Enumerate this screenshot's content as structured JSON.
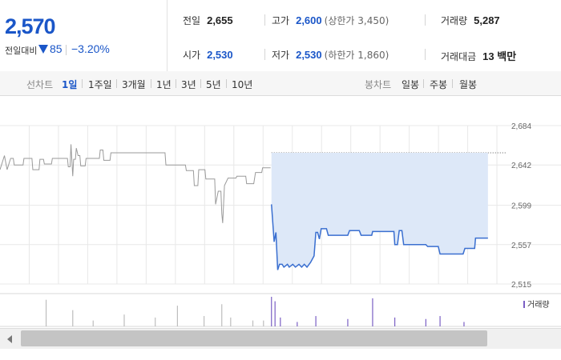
{
  "summary": {
    "current_price": "2,570",
    "change_label": "전일대비",
    "change_amount": "85",
    "change_rate": "−3.20%",
    "stats": {
      "prev_close": {
        "label": "전일",
        "value": "2,655"
      },
      "high": {
        "label": "고가",
        "value": "2,600",
        "sub": "(상한가 3,450)"
      },
      "volume": {
        "label": "거래량",
        "value": "5,287"
      },
      "open": {
        "label": "시가",
        "value": "2,530"
      },
      "low": {
        "label": "저가",
        "value": "2,530",
        "sub": "(하한가 1,860)"
      },
      "trade_value": {
        "label": "거래대금",
        "value": "13 백만"
      }
    }
  },
  "tabs": {
    "line_label": "선차트",
    "line_items": [
      "1일",
      "1주일",
      "3개월",
      "1년",
      "3년",
      "5년",
      "10년"
    ],
    "active": "1일",
    "candle_label": "봉차트",
    "candle_items": [
      "일봉",
      "주봉",
      "월봉"
    ]
  },
  "chart_data": {
    "type": "line",
    "y_ticks": [
      2684,
      2642,
      2599,
      2557,
      2515
    ],
    "ylim": [
      2515,
      2684
    ],
    "prev_close_ref": 2655,
    "grid": true,
    "series": [
      {
        "values": [
          [
            0,
            2637
          ],
          [
            0.5,
            2652
          ],
          [
            0.8,
            2637
          ],
          [
            1.2,
            2649
          ],
          [
            1.5,
            2649
          ],
          [
            1.6,
            2642
          ],
          [
            2.6,
            2642
          ],
          [
            2.7,
            2649
          ],
          [
            3.6,
            2649
          ],
          [
            3.7,
            2637
          ],
          [
            4.4,
            2637
          ],
          [
            4.5,
            2648
          ],
          [
            4.9,
            2648
          ],
          [
            5.0,
            2643
          ],
          [
            5.8,
            2643
          ],
          [
            5.9,
            2649
          ],
          [
            7.6,
            2649
          ],
          [
            7.7,
            2640
          ],
          [
            7.9,
            2640
          ],
          [
            8.0,
            2664
          ],
          [
            8.2,
            2630
          ],
          [
            8.3,
            2648
          ],
          [
            8.5,
            2648
          ],
          [
            8.6,
            2660
          ],
          [
            8.8,
            2652
          ],
          [
            9.0,
            2652
          ],
          [
            9.1,
            2641
          ],
          [
            9.6,
            2641
          ],
          [
            9.7,
            2649
          ],
          [
            11.2,
            2649
          ],
          [
            11.3,
            2658
          ],
          [
            11.6,
            2658
          ],
          [
            11.7,
            2647
          ],
          [
            12.4,
            2647
          ],
          [
            12.5,
            2655
          ],
          [
            18.6,
            2655
          ],
          [
            18.7,
            2642
          ],
          [
            20.9,
            2642
          ],
          [
            21.0,
            2636
          ],
          [
            21.8,
            2636
          ],
          [
            21.9,
            2620
          ],
          [
            22.3,
            2620
          ],
          [
            22.4,
            2637
          ],
          [
            23.1,
            2637
          ],
          [
            23.2,
            2627
          ],
          [
            24.2,
            2627
          ],
          [
            24.3,
            2600
          ],
          [
            24.6,
            2614
          ],
          [
            24.9,
            2614
          ],
          [
            25.0,
            2590
          ],
          [
            25.1,
            2580
          ],
          [
            25.3,
            2620
          ],
          [
            25.7,
            2628
          ],
          [
            26.6,
            2628
          ],
          [
            26.7,
            2630
          ],
          [
            27.7,
            2630
          ],
          [
            27.8,
            2622
          ],
          [
            28.6,
            2622
          ],
          [
            28.8,
            2634
          ],
          [
            29.5,
            2634
          ],
          [
            29.6,
            2639
          ],
          [
            30.5,
            2639
          ]
        ],
        "color": "#9a9a9a"
      },
      {
        "values": [
          [
            30.6,
            2600
          ],
          [
            30.9,
            2560
          ],
          [
            31.1,
            2570
          ],
          [
            31.3,
            2530
          ],
          [
            31.5,
            2536
          ],
          [
            31.8,
            2536
          ],
          [
            32.0,
            2533
          ],
          [
            32.4,
            2536
          ],
          [
            32.6,
            2533
          ],
          [
            33.0,
            2536
          ],
          [
            33.3,
            2533
          ],
          [
            33.7,
            2536
          ],
          [
            34.0,
            2533
          ],
          [
            34.3,
            2536
          ],
          [
            34.6,
            2533
          ],
          [
            35.0,
            2538
          ],
          [
            35.4,
            2545
          ],
          [
            35.6,
            2570
          ],
          [
            35.8,
            2570
          ],
          [
            36.0,
            2563
          ],
          [
            36.2,
            2574
          ],
          [
            36.8,
            2574
          ],
          [
            37.0,
            2567
          ],
          [
            39.2,
            2567
          ],
          [
            39.4,
            2572
          ],
          [
            40.5,
            2572
          ],
          [
            40.7,
            2567
          ],
          [
            41.9,
            2567
          ],
          [
            42.0,
            2571
          ],
          [
            44.4,
            2571
          ],
          [
            44.5,
            2557
          ],
          [
            44.8,
            2557
          ],
          [
            45.0,
            2572
          ],
          [
            45.3,
            2572
          ],
          [
            45.5,
            2557
          ],
          [
            48.0,
            2557
          ],
          [
            48.2,
            2555
          ],
          [
            49.4,
            2555
          ],
          [
            49.6,
            2547
          ],
          [
            52.2,
            2547
          ],
          [
            52.4,
            2553
          ],
          [
            53.5,
            2553
          ],
          [
            53.6,
            2564
          ],
          [
            55.0,
            2564
          ]
        ],
        "color": "#3a6fd0",
        "fill": "#dde8f8"
      }
    ],
    "volume": {
      "legend": "거래량",
      "bars": [
        {
          "x": 5.2,
          "v": 0.9,
          "c": "#bdbdbd"
        },
        {
          "x": 8.2,
          "v": 0.55,
          "c": "#bdbdbd"
        },
        {
          "x": 10.5,
          "v": 0.2,
          "c": "#bdbdbd"
        },
        {
          "x": 14.0,
          "v": 0.4,
          "c": "#bdbdbd"
        },
        {
          "x": 17.5,
          "v": 0.3,
          "c": "#bdbdbd"
        },
        {
          "x": 20.0,
          "v": 0.7,
          "c": "#bdbdbd"
        },
        {
          "x": 23.0,
          "v": 0.35,
          "c": "#bdbdbd"
        },
        {
          "x": 25.0,
          "v": 0.75,
          "c": "#bdbdbd"
        },
        {
          "x": 26.0,
          "v": 0.3,
          "c": "#bdbdbd"
        },
        {
          "x": 28.5,
          "v": 0.2,
          "c": "#bdbdbd"
        },
        {
          "x": 29.7,
          "v": 0.2,
          "c": "#bdbdbd"
        },
        {
          "x": 30.6,
          "v": 1.0,
          "c": "#7a5fc4"
        },
        {
          "x": 31.0,
          "v": 0.85,
          "c": "#7a5fc4"
        },
        {
          "x": 31.6,
          "v": 0.3,
          "c": "#7a5fc4"
        },
        {
          "x": 33.5,
          "v": 0.15,
          "c": "#7a5fc4"
        },
        {
          "x": 35.6,
          "v": 0.35,
          "c": "#7a5fc4"
        },
        {
          "x": 39.2,
          "v": 0.25,
          "c": "#7a5fc4"
        },
        {
          "x": 42.0,
          "v": 0.95,
          "c": "#7a5fc4"
        },
        {
          "x": 44.5,
          "v": 0.3,
          "c": "#7a5fc4"
        },
        {
          "x": 48.0,
          "v": 0.25,
          "c": "#7a5fc4"
        },
        {
          "x": 49.6,
          "v": 0.35,
          "c": "#7a5fc4"
        },
        {
          "x": 52.3,
          "v": 0.15,
          "c": "#7a5fc4"
        }
      ]
    }
  }
}
